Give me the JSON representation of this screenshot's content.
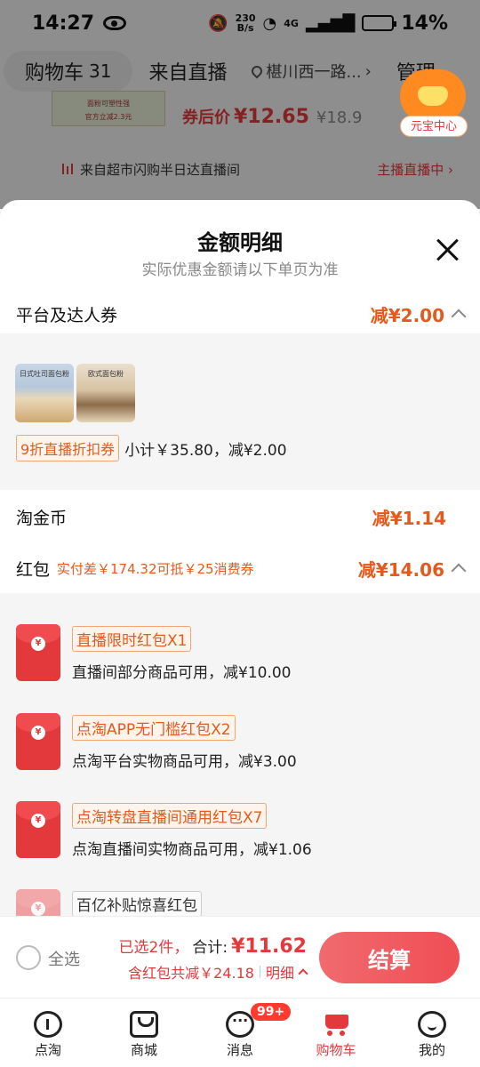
{
  "status_bar": {
    "time": "14:27",
    "net_speed_value": "230",
    "net_speed_unit": "B/s",
    "network": "4G",
    "battery": "14%"
  },
  "top_nav": {
    "cart_tab": "购物车",
    "cart_count": "31",
    "live_tab": "来自直播",
    "location": "椹川西一路...",
    "manage": "管理"
  },
  "background_product": {
    "thumb_label": "面粉可塑性强",
    "thumb_label2": "官方立减2.3元",
    "price_label": "券后价",
    "price": "¥12.65",
    "old_price": "¥18.9"
  },
  "live_banner": {
    "text": "来自超市闪购半日达直播间",
    "status": "主播直播中 ›"
  },
  "ingot_badge": {
    "label": "元宝中心"
  },
  "sheet": {
    "title": "金额明细",
    "subtitle": "实际优惠金额请以下单页为准",
    "coupon_row": {
      "label": "平台及达人券",
      "value": "减¥2.00"
    },
    "coupon_detail": {
      "thumb1_text": "日式吐司面包粉",
      "thumb2_text": "欧式面包粉",
      "tag": "9折直播折扣券",
      "subtotal": "小计￥35.80，减¥2.00"
    },
    "gold_row": {
      "label": "淘金币",
      "value": "减¥1.14"
    },
    "redpack_row": {
      "label": "红包",
      "sub": "实付差￥174.32可抵￥25消费券",
      "value": "减¥14.06"
    },
    "redpacks": [
      {
        "name": "直播限时红包X1",
        "desc": "直播间部分商品可用，减¥10.00"
      },
      {
        "name": "点淘APP无门槛红包X2",
        "desc": "点淘平台实物商品可用，减¥3.00"
      },
      {
        "name": "点淘转盘直播间通用红包X7",
        "desc": "点淘直播间实物商品可用，减¥1.06"
      },
      {
        "name": "百亿补贴惊喜红包",
        "desc": ""
      }
    ],
    "coin_symbol": "¥"
  },
  "checkout": {
    "select_all": "全选",
    "selected": "已选2件，",
    "total_label": "合计:",
    "total": "¥11.62",
    "discount": "含红包共减￥24.18",
    "detail": "明细",
    "pay": "结算"
  },
  "tabbar": {
    "items": [
      {
        "label": "点淘",
        "icon": "home-icon"
      },
      {
        "label": "商城",
        "icon": "mall-icon"
      },
      {
        "label": "消息",
        "icon": "message-icon"
      },
      {
        "label": "购物车",
        "icon": "cart-icon"
      },
      {
        "label": "我的",
        "icon": "me-icon"
      }
    ],
    "message_badge": "99+"
  },
  "colors": {
    "accent_red": "#e4393c",
    "discount_orange": "#e55a1c",
    "pay_button": "#ef4e55"
  }
}
